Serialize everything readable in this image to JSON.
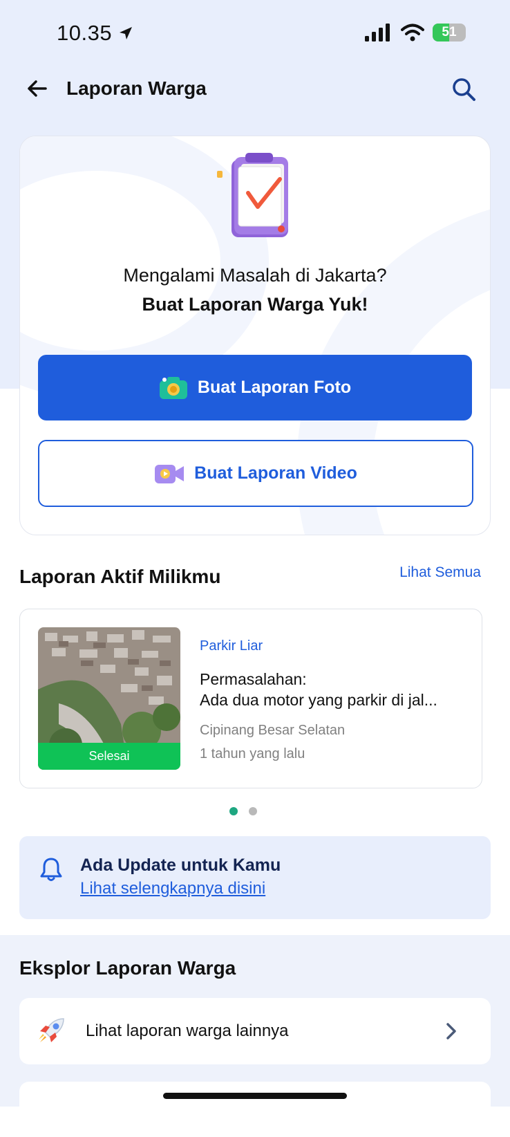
{
  "status_bar": {
    "time": "10.35",
    "battery": "51",
    "battery_level": 0.51
  },
  "header": {
    "title": "Laporan Warga"
  },
  "hero": {
    "line1": "Mengalami Masalah di Jakarta?",
    "line2": "Buat Laporan Warga Yuk!",
    "photo_button": "Buat Laporan Foto",
    "video_button": "Buat Laporan Video"
  },
  "active_reports": {
    "title": "Laporan Aktif Milikmu",
    "see_all": "Lihat Semua",
    "items": [
      {
        "status": "Selesai",
        "category": "Parkir Liar",
        "problem_label": "Permasalahan:",
        "problem": "Ada dua motor yang parkir di jal...",
        "location": "Cipinang Besar Selatan",
        "time_ago": "1 tahun yang lalu"
      }
    ],
    "pagination": {
      "total": 2,
      "active": 1
    }
  },
  "update_banner": {
    "title": "Ada Update untuk Kamu",
    "link": "Lihat selengkapnya disini"
  },
  "explore": {
    "title": "Eksplor Laporan Warga",
    "items": [
      {
        "label": "Lihat laporan warga lainnya",
        "icon": "rocket-icon"
      }
    ]
  },
  "colors": {
    "primary": "#1f5ddc",
    "success": "#0fc256",
    "header_bg": "#e8eefc"
  }
}
